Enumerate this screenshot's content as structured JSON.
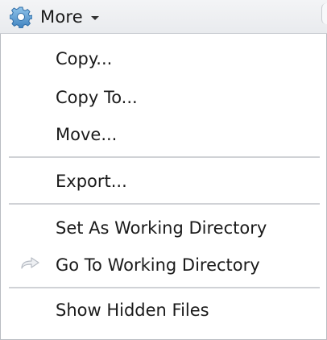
{
  "toolbar": {
    "more_label": "More",
    "gear_icon": "gear-icon",
    "caret_icon": "chevron-down-icon"
  },
  "menu": {
    "items": [
      {
        "label": "Copy..."
      },
      {
        "label": "Copy To..."
      },
      {
        "label": "Move..."
      },
      {
        "label": "Export..."
      },
      {
        "label": "Set As Working Directory"
      },
      {
        "label": "Go To Working Directory",
        "icon": "go-to-arrow-icon"
      },
      {
        "label": "Show Hidden Files"
      }
    ]
  }
}
